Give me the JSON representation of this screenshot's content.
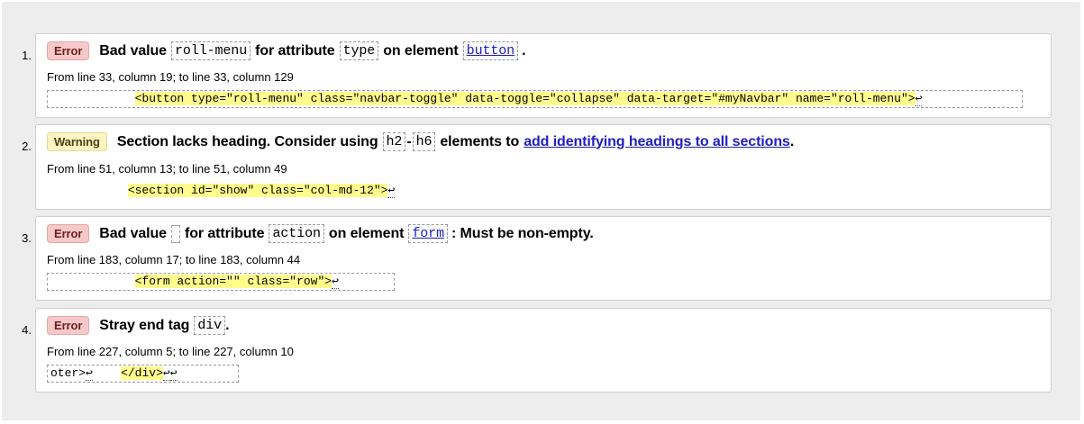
{
  "messages": [
    {
      "number": "1.",
      "type": "Error",
      "parts": {
        "t1": "Bad value",
        "c1": "roll-menu",
        "t2": "for attribute",
        "c2": "type",
        "t3": "on element",
        "c3": "button",
        "t4": "."
      },
      "location": "From line 33, column 19; to line 33, column 129",
      "extract_pre": "            ",
      "extract_hl": "<button type=\"roll-menu\" class=\"navbar-toggle\" data-toggle=\"collapse\" data-target=\"#myNavbar\" name=\"roll-menu\">",
      "extract_post": ""
    },
    {
      "number": "2.",
      "type": "Warning",
      "parts": {
        "t1": "Section lacks heading. Consider using",
        "c1": "h2",
        "dash": "-",
        "c2": "h6",
        "t2": "elements to",
        "link": "add identifying headings to all sections",
        "t3": "."
      },
      "location": "From line 51, column 13; to line 51, column 49",
      "extract_pre": "           ",
      "extract_hl": "<section id=\"show\" class=\"col-md-12\">",
      "extract_post": ""
    },
    {
      "number": "3.",
      "type": "Error",
      "parts": {
        "t1": "Bad value",
        "c1": "",
        "t2": "for attribute",
        "c2": "action",
        "t3": "on element",
        "c3": "form",
        "t4": ": Must be non-empty."
      },
      "location": "From line 183, column 17; to line 183, column 44",
      "extract_pre": "            ",
      "extract_hl": "<form action=\"\" class=\"row\">",
      "extract_post": ""
    },
    {
      "number": "4.",
      "type": "Error",
      "parts": {
        "t1": "Stray end tag",
        "c1": "div",
        "t2": "."
      },
      "location": "From line 227, column 5; to line 227, column 10",
      "extract_pre": "oter>",
      "extract_mid": "    ",
      "extract_hl": "</div>",
      "extract_post": ""
    }
  ],
  "return_glyph": "↩",
  "colors": {
    "error_badge": "#f6c9c9",
    "warning_badge": "#fbf5c4",
    "highlight": "#fffc8c",
    "link": "#2020c0"
  }
}
